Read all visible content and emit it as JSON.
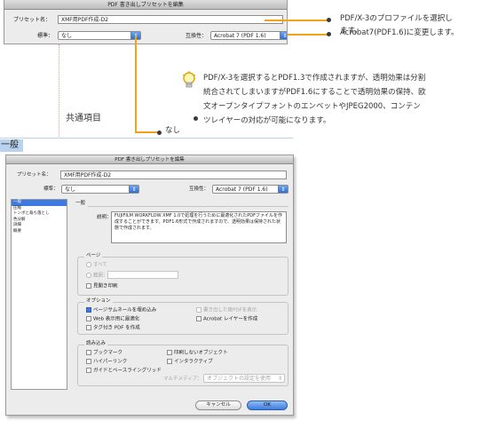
{
  "top_dialog": {
    "title": "PDF 書き出しプリセットを編集",
    "preset_label": "プリセット名：",
    "preset_value": "XMF用PDF作成-D2",
    "standard_label": "標準：",
    "standard_value": "なし",
    "compat_label": "互換性：",
    "compat_value": "Acrobat 7 (PDF 1.6)"
  },
  "notes": {
    "note1_line1": "PDF/X-3のプロファイルを選択し",
    "note1_line2": "ます。",
    "note2": "Acrobat7(PDF1.6)に変更します。",
    "note3_line1": "PDF/X-3を選択するとPDF1.3で作成されますが、透明効果は分割",
    "note3_line2": "統合されてしまいますがPDF1.6にすることで透明効果の保持、欧",
    "note3_line3": "文オープンタイプフォントのエンベットやJPEG2000、コンテン",
    "note3_line4": "ツレイヤーの対応が可能になります。",
    "nashi": "なし",
    "common_items": "共通項目",
    "section_general": "一般"
  },
  "main_dialog": {
    "title": "PDF 書き出しプリセットを編集",
    "preset_label": "プリセット名：",
    "preset_value": "XMF用PDF作成-D2",
    "standard_label": "標準：",
    "standard_value": "なし",
    "compat_label": "互換性：",
    "compat_value": "Acrobat 7 (PDF 1.6)",
    "sidebar_items": [
      "一般",
      "圧縮",
      "トンボと裁ち落とし",
      "色分解",
      "詳細",
      "概要"
    ],
    "panel_title": "一般",
    "desc_label": "説明：",
    "desc_text": "FUJIFILM WORKFLOW XMF 1.0で処理を行うために最適化されたPDFファイルを作成することができます。PDF1.6形式で作成されますので、透明効果は保持された状態で作成されます。",
    "pages_title": "ページ",
    "pages_all": "すべて",
    "pages_range": "範囲：",
    "pages_spreads": "見開き印刷",
    "options_title": "オプション",
    "opt_embed_thumbs": "ページサムネールを埋め込み",
    "opt_web": "Web 表示用に最適化",
    "opt_tagged": "タグ付き PDF を作成",
    "opt_view_after": "書き出した後PDFを表示",
    "opt_acrobat_layers": "Acrobat レイヤーを作成",
    "include_title": "読み込み",
    "inc_bookmarks": "ブックマーク",
    "inc_hyperlinks": "ハイパーリンク",
    "inc_guides": "ガイドとベースライングリッド",
    "inc_nonprint": "印刷しないオブジェクト",
    "inc_interactive": "インタラクティブ",
    "multimedia_label": "マルチメディア：",
    "multimedia_value": "オブジェクトの設定を使用",
    "cancel": "キャンセル",
    "ok": "OK"
  },
  "colors": {
    "accent_orange": "#f2a31b",
    "mac_blue": "#3d7be0",
    "section_tab_blue": "#b9d3ee"
  }
}
